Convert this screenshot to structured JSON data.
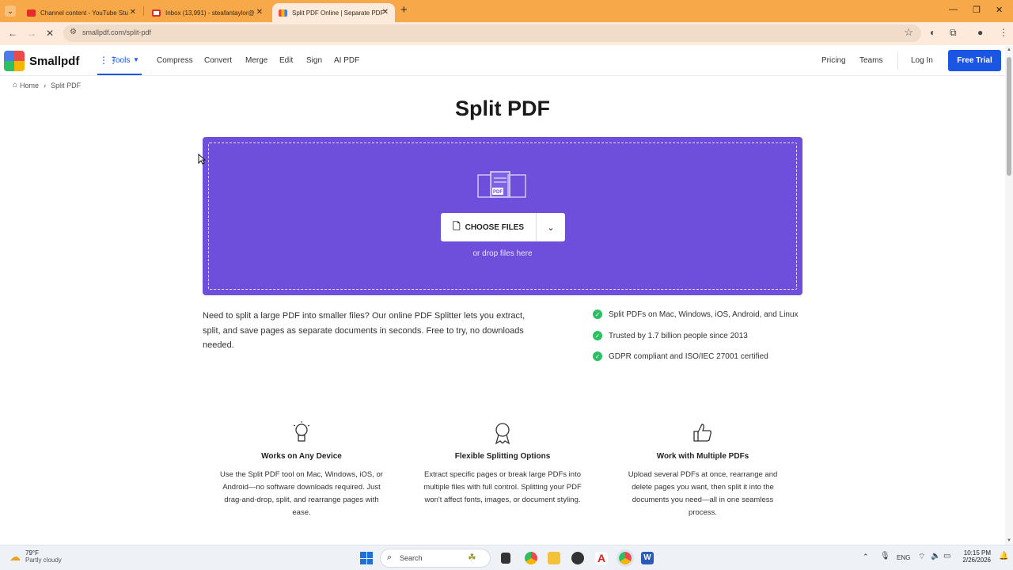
{
  "browser": {
    "tabs": [
      {
        "title": "Channel content - YouTube Stu",
        "icon_color": "#e52d27"
      },
      {
        "title": "Inbox (13,991) - steafantaylor@",
        "icon_color": "#d93025"
      },
      {
        "title": "Split PDF Online | Separate PDF",
        "icon_color": "#7b5ce0"
      }
    ],
    "new_tab": "+",
    "url": "smallpdf.com/split-pdf"
  },
  "site": {
    "logo": "Smallpdf",
    "nav": {
      "tools": "Tools",
      "items": [
        "Compress",
        "Convert",
        "Merge",
        "Edit",
        "Sign",
        "AI PDF"
      ]
    },
    "right": {
      "pricing": "Pricing",
      "teams": "Teams",
      "login": "Log In",
      "trial": "Free Trial"
    },
    "breadcrumb": {
      "home": "Home",
      "current": "Split PDF"
    },
    "accent": "#6e4fdb"
  },
  "main": {
    "title": "Split PDF",
    "choose_label": "CHOOSE FILES",
    "drop_text": "or drop files here",
    "description": "Need to split a large PDF into smaller files? Our online PDF Splitter lets you extract, split, and save pages as separate documents in seconds. Free to try, no downloads needed.",
    "checks": [
      "Split PDFs on Mac, Windows, iOS, Android, and Linux",
      "Trusted by 1.7 billion people since 2013",
      "GDPR compliant and ISO/IEC 27001 certified"
    ],
    "features": [
      {
        "title": "Works on Any Device",
        "text": "Use the Split PDF tool on Mac, Windows, iOS, or Android—no software downloads required. Just drag-and-drop, split, and rearrange pages with ease."
      },
      {
        "title": "Flexible Splitting Options",
        "text": "Extract specific pages or break large PDFs into multiple files with full control. Splitting your PDF won't affect fonts, images, or document styling."
      },
      {
        "title": "Work with Multiple PDFs",
        "text": "Upload several PDFs at once, rearrange and delete pages you want, then split it into the documents you need—all in one seamless process."
      }
    ]
  },
  "taskbar": {
    "weather_temp": "79°F",
    "weather_desc": "Partly cloudy",
    "search": "Search",
    "lang": "ENG",
    "time": "10:15 PM",
    "date": "2/26/2026"
  }
}
